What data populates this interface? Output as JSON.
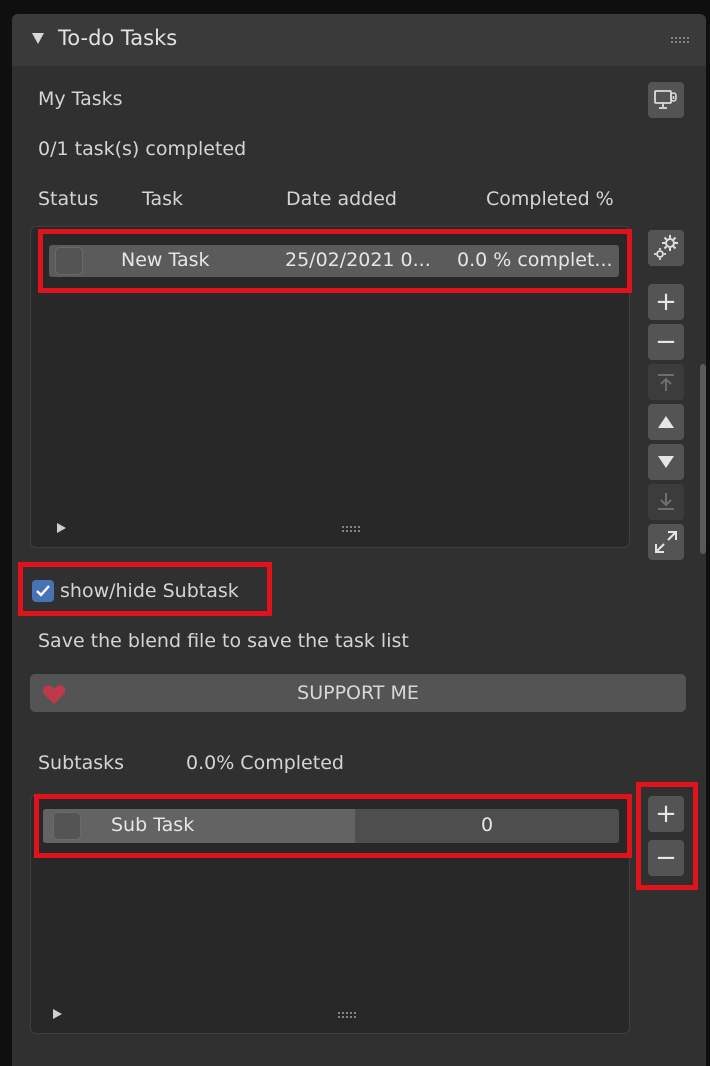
{
  "panel": {
    "title": "To-do Tasks"
  },
  "tasks": {
    "header": "My Tasks",
    "summary": "0/1 task(s) completed",
    "columns": [
      "Status",
      "Task",
      "Date added",
      "Completed %"
    ],
    "rows": [
      {
        "checked": false,
        "task": "New Task",
        "date": "25/02/2021 0...",
        "completed": "0.0 % complet..."
      }
    ]
  },
  "side_buttons": {
    "add": "+",
    "remove": "−"
  },
  "subtask_toggle": {
    "label": "show/hide Subtask",
    "checked": true
  },
  "note": "Save the blend file to save the task list",
  "support": {
    "label": "SUPPORT ME"
  },
  "subtasks": {
    "header": "Subtasks",
    "summary": "0.0% Completed",
    "rows": [
      {
        "checked": false,
        "name": "Sub Task",
        "value": "0"
      }
    ]
  },
  "colors": {
    "accent": "#4772b3",
    "highlight": "#e0121c",
    "heart": "#c0394a"
  },
  "icons": {
    "header_arrow": "triangle-down-icon",
    "monitor": "monitor-link-icon",
    "settings": "gear-icon",
    "move_top": "move-top-icon",
    "move_up": "triangle-up-icon",
    "move_down": "triangle-down-icon",
    "move_bottom": "move-bottom-icon",
    "expand": "expand-icon",
    "heart": "heart-icon"
  }
}
